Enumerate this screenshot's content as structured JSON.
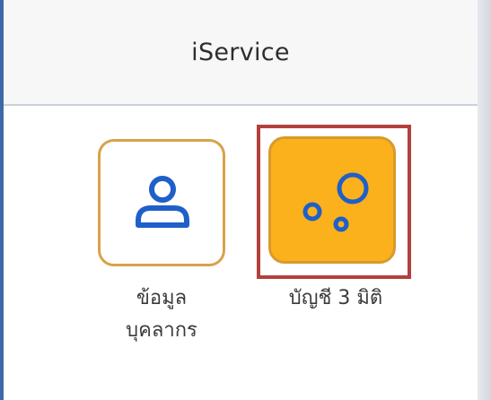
{
  "header": {
    "title": "iService"
  },
  "tiles": [
    {
      "icon": "user-icon",
      "label_line1": "ข้อมูล",
      "label_line2": "บุคลากร"
    },
    {
      "icon": "bubbles-icon",
      "label_line1": "บัญชี 3 มิติ"
    }
  ],
  "colors": {
    "accent_orange": "#fbb11b",
    "tile_border": "#d8a24a",
    "icon_blue": "#1f5fc9",
    "highlight_red": "#b3403c"
  }
}
